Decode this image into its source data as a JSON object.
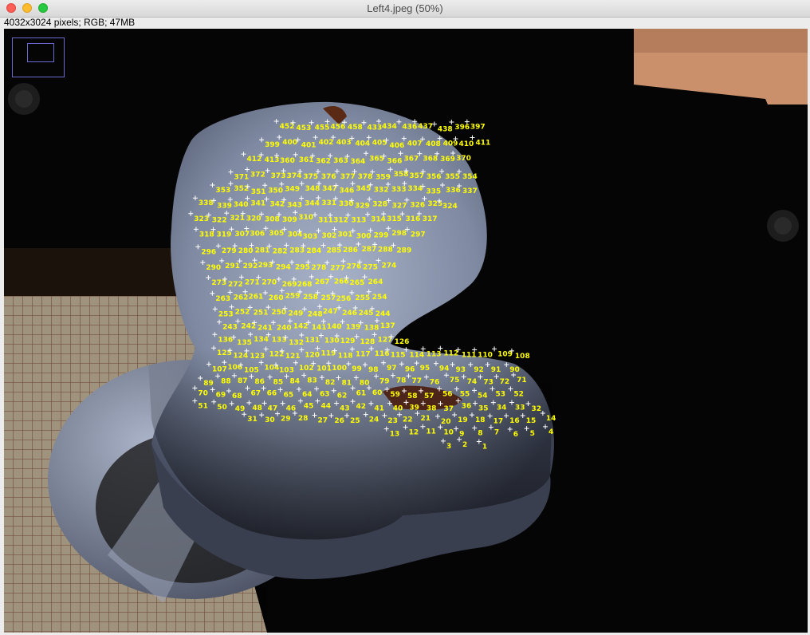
{
  "window": {
    "title": "Left4.jpeg (50%)"
  },
  "image_info": "4032x3024 pixels; RGB; 47MB",
  "marker_color": "#ffff00",
  "marker_labels": [
    "452",
    "453",
    "455",
    "456",
    "458",
    "433",
    "434",
    "436",
    "437",
    "438",
    "396",
    "397",
    "399",
    "400",
    "401",
    "402",
    "403",
    "404",
    "405",
    "406",
    "407",
    "408",
    "409",
    "410",
    "411",
    "412",
    "413",
    "360",
    "361",
    "362",
    "363",
    "364",
    "365",
    "366",
    "367",
    "368",
    "369",
    "370",
    "371",
    "372",
    "373",
    "374",
    "375",
    "376",
    "377",
    "378",
    "359",
    "358",
    "357",
    "356",
    "355",
    "354",
    "353",
    "352",
    "351",
    "350",
    "349",
    "348",
    "347",
    "346",
    "345",
    "332",
    "333",
    "334",
    "335",
    "336",
    "337",
    "338",
    "339",
    "340",
    "341",
    "342",
    "343",
    "344",
    "331",
    "330",
    "329",
    "328",
    "327",
    "326",
    "325",
    "324",
    "323",
    "322",
    "321",
    "320",
    "308",
    "309",
    "310",
    "311",
    "312",
    "313",
    "314",
    "315",
    "316",
    "317",
    "318",
    "319",
    "307",
    "306",
    "305",
    "304",
    "303",
    "302",
    "301",
    "300",
    "299",
    "298",
    "297",
    "296",
    "279",
    "280",
    "281",
    "282",
    "283",
    "284",
    "285",
    "286",
    "287",
    "288",
    "289",
    "290",
    "291",
    "292",
    "293",
    "294",
    "295",
    "278",
    "277",
    "276",
    "275",
    "274",
    "273",
    "272",
    "271",
    "270",
    "269",
    "268",
    "267",
    "266",
    "265",
    "264",
    "263",
    "262",
    "261",
    "260",
    "259",
    "258",
    "257",
    "256",
    "255",
    "254",
    "253",
    "252",
    "251",
    "250",
    "249",
    "248",
    "247",
    "246",
    "245",
    "244",
    "243",
    "242",
    "241",
    "240",
    "142",
    "141",
    "140",
    "139",
    "138",
    "137",
    "136",
    "135",
    "134",
    "133",
    "132",
    "131",
    "130",
    "129",
    "128",
    "127",
    "126",
    "125",
    "124",
    "123",
    "122",
    "121",
    "120",
    "119",
    "118",
    "117",
    "116",
    "115",
    "114",
    "113",
    "112",
    "111",
    "110",
    "109",
    "108",
    "107",
    "106",
    "105",
    "104",
    "103",
    "102",
    "101",
    "100",
    "99",
    "98",
    "97",
    "96",
    "95",
    "94",
    "93",
    "92",
    "91",
    "90",
    "89",
    "88",
    "87",
    "86",
    "85",
    "84",
    "83",
    "82",
    "81",
    "80",
    "79",
    "78",
    "77",
    "76",
    "75",
    "74",
    "73",
    "72",
    "71",
    "70",
    "69",
    "68",
    "67",
    "66",
    "65",
    "64",
    "63",
    "62",
    "61",
    "60",
    "59",
    "58",
    "57",
    "56",
    "55",
    "54",
    "53",
    "52",
    "51",
    "50",
    "49",
    "48",
    "47",
    "46",
    "45",
    "44",
    "43",
    "42",
    "41",
    "40",
    "39",
    "38",
    "37",
    "36",
    "35",
    "34",
    "33",
    "32",
    "31",
    "30",
    "29",
    "28",
    "27",
    "26",
    "25",
    "24",
    "23",
    "22",
    "21",
    "20",
    "19",
    "18",
    "17",
    "16",
    "15",
    "14",
    "13",
    "12",
    "11",
    "10",
    "9",
    "8",
    "7",
    "6",
    "5",
    "4",
    "3",
    "2",
    "1"
  ]
}
